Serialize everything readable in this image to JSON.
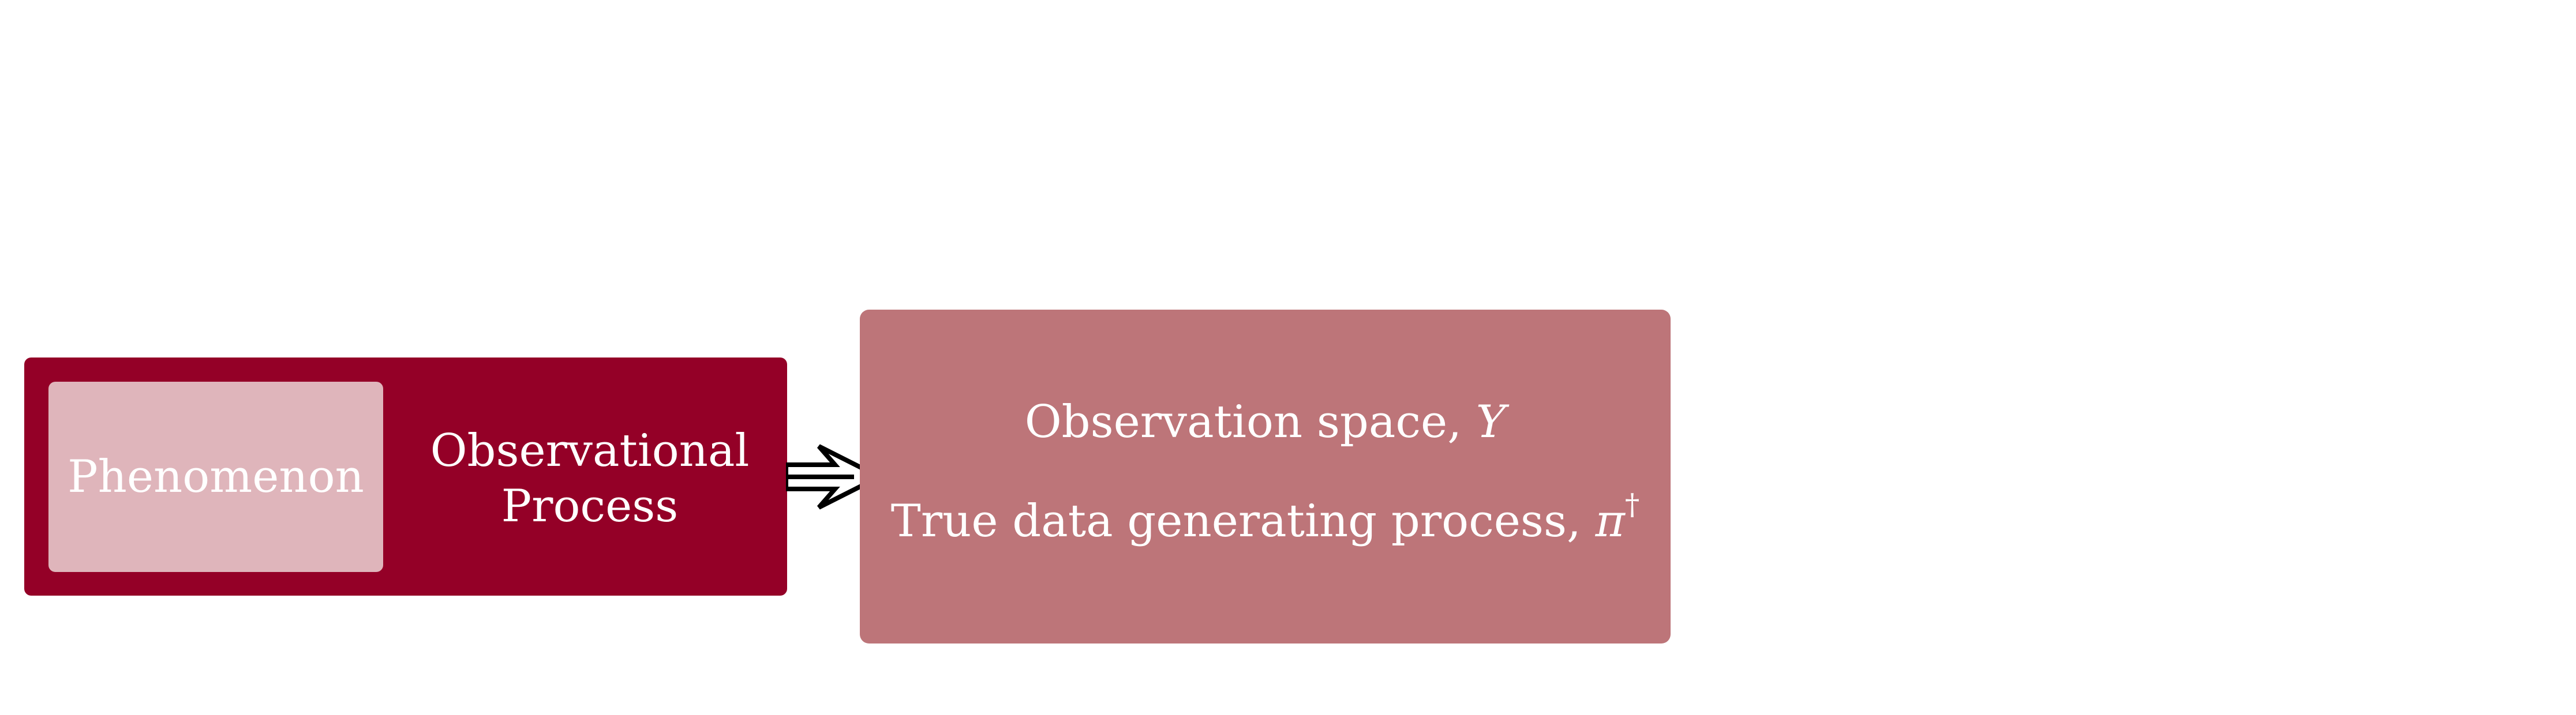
{
  "diagram": {
    "phenomenon_label": "Phenomenon",
    "process_label_line1": "Observational",
    "process_label_line2": "Process",
    "observation_text": "Observation space, ",
    "observation_symbol": "Y",
    "dgp_text": "True data generating process, ",
    "dgp_symbol": "π",
    "dgp_superscript": "†"
  },
  "colors": {
    "outer_box": "#940027",
    "inner_box": "#dfb5bb",
    "observation_box": "#bd7579",
    "text": "#ffffff",
    "arrow_outline": "#000000",
    "arrow_fill": "#ffffff"
  },
  "icons": {
    "connector": "double-line-right-arrow-icon"
  }
}
